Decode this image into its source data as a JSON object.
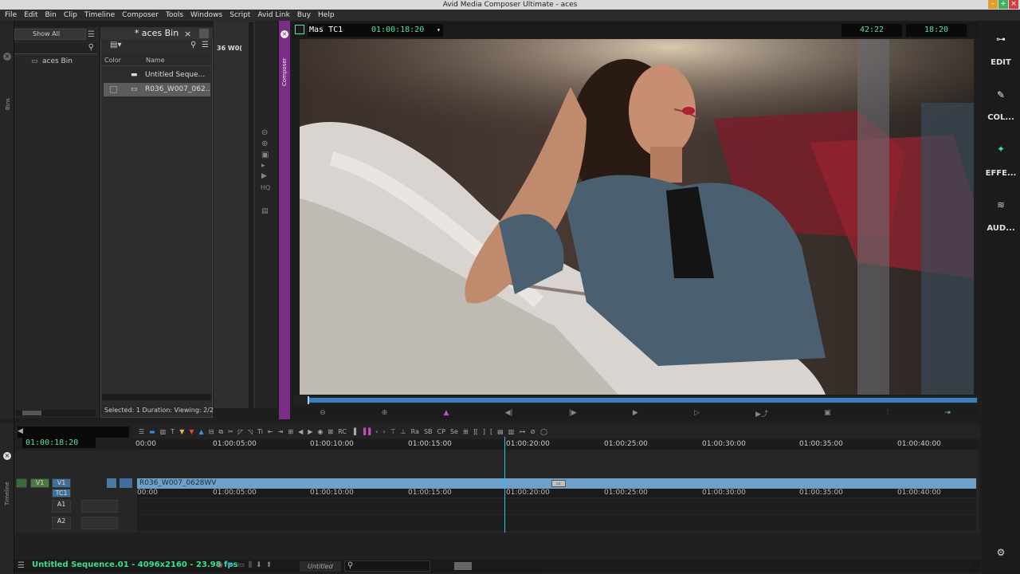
{
  "window": {
    "title": "Avid Media Composer Ultimate - aces"
  },
  "menu": [
    "File",
    "Edit",
    "Bin",
    "Clip",
    "Timeline",
    "Composer",
    "Tools",
    "Windows",
    "Script",
    "Avid Link",
    "Buy",
    "Help"
  ],
  "bins": {
    "rail_label": "Bins",
    "show_all": "Show All",
    "bin_name": "aces Bin",
    "open_bin_title": "* aces Bin",
    "columns": [
      "Color",
      "Name"
    ],
    "rows": [
      "Untitled Seque...",
      "R036_W007_062..."
    ],
    "status": "Selected: 1  Duration:  Viewing: 2/2",
    "source_partial": "36 W0("
  },
  "composer": {
    "rail_label": "Composer",
    "tc_label": "Mas TC1",
    "tc_value": "01:00:18:20",
    "counter_a": "42:22",
    "counter_b": "18:20"
  },
  "right_rail": {
    "items": [
      "EDIT",
      "COL...",
      "EFFE...",
      "AUD..."
    ]
  },
  "timeline": {
    "rail_label": "Timeline",
    "tc": "01:00:18:20",
    "ruler": [
      "00:00",
      "01:00:05:00",
      "01:00:10:00",
      "01:00:15:00",
      "01:00:20:00",
      "01:00:25:00",
      "01:00:30:00",
      "01:00:35:00",
      "01:00:40:00"
    ],
    "clip_name": "R036_W007_0628WV",
    "tracks": [
      "V1",
      "TC1",
      "A1",
      "A2"
    ],
    "toolbar_labels": [
      "RC",
      "Ra",
      "SB",
      "CP",
      "Se"
    ],
    "sequence_info": "Untitled Sequence.01 - 4096x2160 - 23.98 fps",
    "bottom_field": "Untitled"
  },
  "colors": {
    "accent_green": "#5ae0a0",
    "clip_blue": "#6fa0c8",
    "composer_purple": "#7b2d88",
    "playhead": "#2fc0e8"
  }
}
